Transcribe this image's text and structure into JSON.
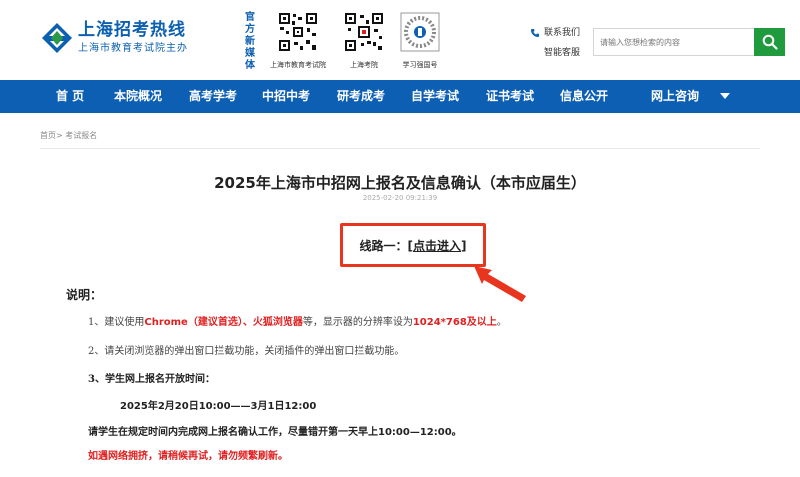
{
  "header": {
    "logo_title": "上海招考热线",
    "logo_subtitle": "上海市教育考试院主办",
    "media_label": "官方新媒体",
    "qr_codes": [
      {
        "caption": "上海市教育考试院"
      },
      {
        "caption": "上海考院"
      },
      {
        "caption": "学习强国号"
      }
    ],
    "contact_us": "联系我们",
    "smart_service": "智能客服",
    "search_placeholder": "请输入您想检索的内容",
    "search_icon": "search-icon",
    "accent_color": "#0d5fb3",
    "search_button_color": "#1f9b3d"
  },
  "nav": {
    "items": [
      "首 页",
      "本院概况",
      "高考学考",
      "中招中考",
      "研考成考",
      "自学考试",
      "证书考试",
      "信息公开",
      "网上咨询"
    ]
  },
  "breadcrumb": {
    "home": "首页",
    "separator": ">",
    "current": "考试报名"
  },
  "article": {
    "title": "2025年上海市中招网上报名及信息确认（本市应届生）",
    "date": "2025-02-20 09:21:39",
    "route_label": "线路一：",
    "route_bracket_open": "[",
    "route_link": "点击进入",
    "route_bracket_close": "]",
    "highlight_color": "#e8351f",
    "intro_label": "说明：",
    "item1_prefix": "1、建议使用",
    "item1_browser1": "Chrome（建议首选）、火狐浏览器",
    "item1_mid": "等，显示器的分辨率设为",
    "item1_resolution": "1024*768及以上",
    "item1_suffix": "。",
    "item2": "2、请关闭浏览器的弹出窗口拦截功能，关闭插件的弹出窗口拦截功能。",
    "item3": "3、学生网上报名开放时间：",
    "schedule": "2025年2月20日10:00——3月1日12:00",
    "notice_prefix": "请学生在规定时间内完成网上报名确认工作，尽量错开第一天早上",
    "notice_time": "10:00—12:00",
    "notice_suffix": "。",
    "network_notice": "如遇网络拥挤，请稍候再试，请勿频繁刷新。"
  }
}
